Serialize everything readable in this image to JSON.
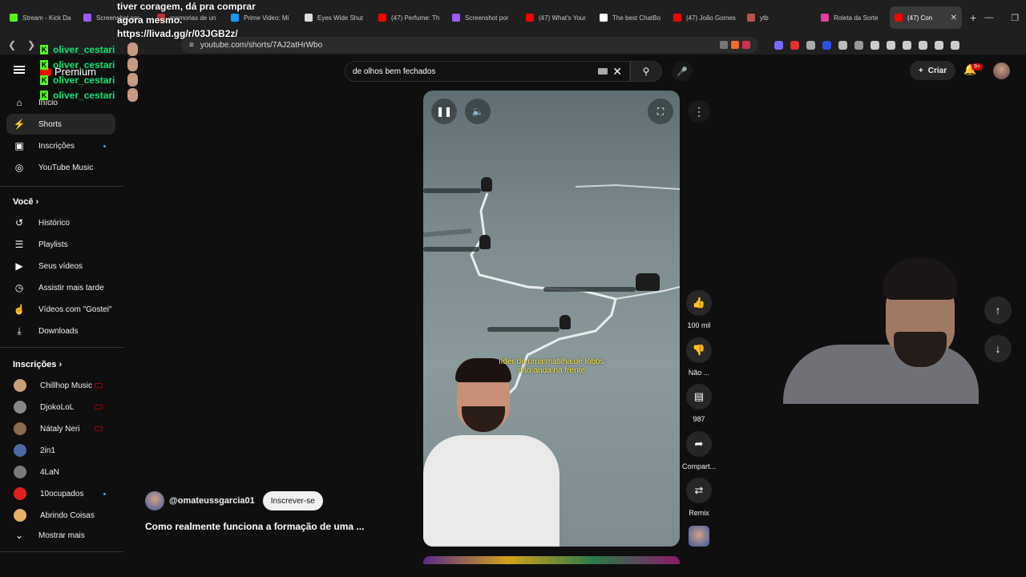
{
  "browser": {
    "tabs": [
      {
        "label": "Stream - Kick Da",
        "color": "#53fc18",
        "active": false
      },
      {
        "label": "Screenshot por",
        "color": "#9b59ff",
        "active": false
      },
      {
        "label": "memorias de un",
        "color": "#c03030",
        "active": false
      },
      {
        "label": "Prime Video: Mi",
        "color": "#1a98ff",
        "active": false
      },
      {
        "label": "Eyes Wide Shut",
        "color": "#dddddd",
        "active": false
      },
      {
        "label": "(47) Perfume: Th",
        "color": "#ff0000",
        "active": false
      },
      {
        "label": "Screenshot por",
        "color": "#9b59ff",
        "active": false
      },
      {
        "label": "(47) What's Your",
        "color": "#ff0000",
        "active": false
      },
      {
        "label": "The best ChatBo",
        "color": "#ffffff",
        "active": false
      },
      {
        "label": "(47) João Gomes",
        "color": "#ff0000",
        "active": false
      },
      {
        "label": "ytb",
        "color": "#c05050",
        "active": false
      },
      {
        "label": "Roleta da Sorte",
        "color": "#e040a0",
        "active": false
      },
      {
        "label": "(47) Con",
        "color": "#ff0000",
        "active": true
      }
    ],
    "new_tab": "+",
    "url": "youtube.com/shorts/7AJ2atHrWbo"
  },
  "overlay": {
    "line1": "tiver coragem, dá pra comprar",
    "line2": "agora mesmo.",
    "line3": "https://livad.gg/r/03JGB2z/"
  },
  "chat": {
    "entries": [
      {
        "user": "oliver_cestari"
      },
      {
        "user": "oliver_cestari"
      },
      {
        "user": "oliver_cestari"
      },
      {
        "user": "oliver_cestari"
      }
    ]
  },
  "youtube": {
    "logo": "Premium",
    "search": {
      "value": "de olhos bem fechados"
    },
    "create_label": "Criar",
    "notif_count": "9+"
  },
  "sidebar": {
    "main": [
      {
        "label": "Início",
        "icon": "home-icon"
      },
      {
        "label": "Shorts",
        "icon": "shorts-icon",
        "active": true
      },
      {
        "label": "Inscrições",
        "icon": "subscriptions-icon",
        "dot": true
      },
      {
        "label": "YouTube Music",
        "icon": "music-icon"
      }
    ],
    "you_title": "Você",
    "you": [
      {
        "label": "Histórico",
        "icon": "history-icon"
      },
      {
        "label": "Playlists",
        "icon": "playlists-icon"
      },
      {
        "label": "Seus vídeos",
        "icon": "your-videos-icon"
      },
      {
        "label": "Assistir mais tarde",
        "icon": "watch-later-icon"
      },
      {
        "label": "Vídeos com \"Gostei\"",
        "icon": "like-icon"
      },
      {
        "label": "Downloads",
        "icon": "download-icon"
      }
    ],
    "subs_title": "Inscrições",
    "subs": [
      {
        "label": "Chillhop Music",
        "color": "#c8a070",
        "live": true
      },
      {
        "label": "DjokoLoL",
        "color": "#888888",
        "live": true
      },
      {
        "label": "Nátaly Neri",
        "color": "#8a6a50",
        "live": true
      },
      {
        "label": "2in1",
        "color": "#4a6aa0",
        "live": false
      },
      {
        "label": "4LaN",
        "color": "#7a7a7a",
        "live": false
      },
      {
        "label": "10ocupados",
        "color": "#e02020",
        "dot": true
      },
      {
        "label": "Abrindo Coisas",
        "color": "#e8b060",
        "live": false
      }
    ],
    "show_more": "Mostrar mais"
  },
  "short": {
    "caption_line1": "líder de uma matilha de lobos",
    "caption_line2": "não anda na frente",
    "channel": "@omateussgarcia01",
    "subscribe_label": "Inscrever-se",
    "title": "Como realmente funciona a formação de uma ...",
    "actions": [
      {
        "label": "100 mil",
        "icon": "like-icon"
      },
      {
        "label": "Não ...",
        "icon": "dislike-icon"
      },
      {
        "label": "987",
        "icon": "comment-icon"
      },
      {
        "label": "Compart...",
        "icon": "share-icon"
      },
      {
        "label": "Remix",
        "icon": "remix-icon"
      }
    ]
  }
}
